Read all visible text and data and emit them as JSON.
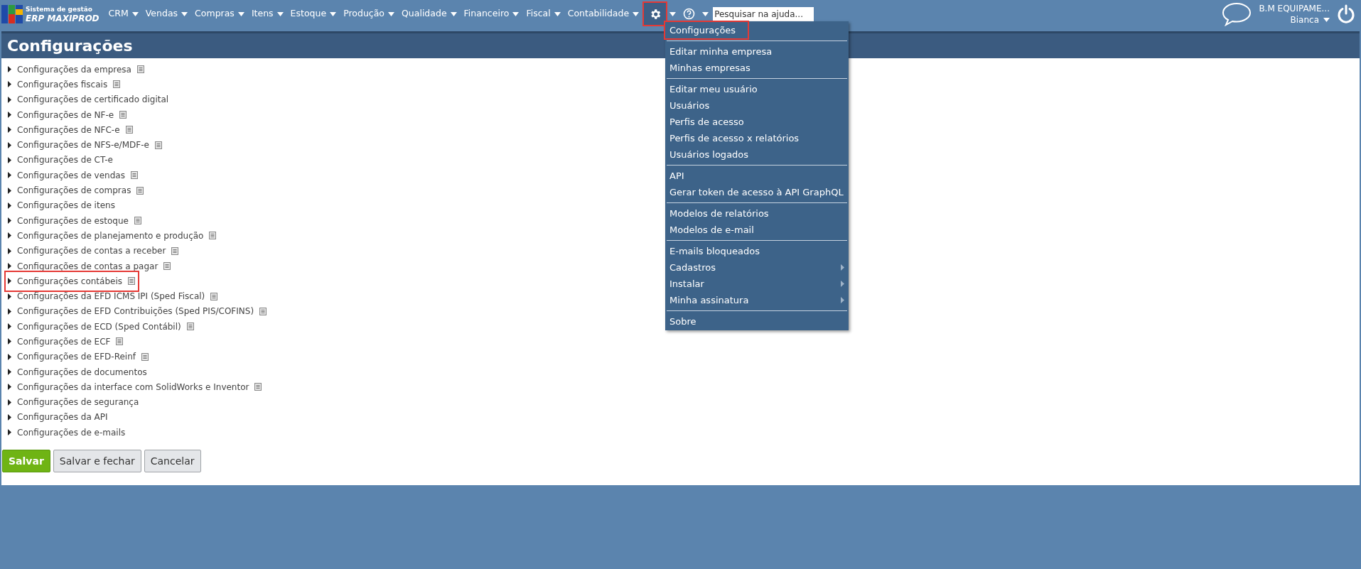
{
  "logo": {
    "line_1": "Sistema de gestão",
    "line_2": "ERP MAXIPROD"
  },
  "nav": [
    {
      "label": "CRM"
    },
    {
      "label": "Vendas"
    },
    {
      "label": "Compras"
    },
    {
      "label": "Itens"
    },
    {
      "label": "Estoque"
    },
    {
      "label": "Produção"
    },
    {
      "label": "Qualidade"
    },
    {
      "label": "Financeiro"
    },
    {
      "label": "Fiscal"
    },
    {
      "label": "Contabilidade"
    }
  ],
  "settings_button": {
    "highlighted": true
  },
  "search": {
    "placeholder": "Pesquisar na ajuda..."
  },
  "user": {
    "company": "B.M EQUIPAME...",
    "name": "Bianca"
  },
  "page_title": "Configurações",
  "sections": [
    {
      "label": "Configurações da empresa",
      "doc": true,
      "highlighted": false
    },
    {
      "label": "Configurações fiscais",
      "doc": true,
      "highlighted": false
    },
    {
      "label": "Configurações de certificado digital",
      "doc": false,
      "highlighted": false
    },
    {
      "label": "Configurações de NF-e",
      "doc": true,
      "highlighted": false
    },
    {
      "label": "Configurações de NFC-e",
      "doc": true,
      "highlighted": false
    },
    {
      "label": "Configurações de NFS-e/MDF-e",
      "doc": true,
      "highlighted": false
    },
    {
      "label": "Configurações de CT-e",
      "doc": false,
      "highlighted": false
    },
    {
      "label": "Configurações de vendas",
      "doc": true,
      "highlighted": false
    },
    {
      "label": "Configurações de compras",
      "doc": true,
      "highlighted": false
    },
    {
      "label": "Configurações de itens",
      "doc": false,
      "highlighted": false
    },
    {
      "label": "Configurações de estoque",
      "doc": true,
      "highlighted": false
    },
    {
      "label": "Configurações de planejamento e produção",
      "doc": true,
      "highlighted": false
    },
    {
      "label": "Configurações de contas a receber",
      "doc": true,
      "highlighted": false
    },
    {
      "label": "Configurações de contas a pagar",
      "doc": true,
      "highlighted": false
    },
    {
      "label": "Configurações contábeis",
      "doc": true,
      "highlighted": true
    },
    {
      "label": "Configurações da EFD ICMS IPI (Sped Fiscal)",
      "doc": true,
      "highlighted": false
    },
    {
      "label": "Configurações de EFD Contribuições (Sped PIS/COFINS)",
      "doc": true,
      "highlighted": false
    },
    {
      "label": "Configurações de ECD (Sped Contábil)",
      "doc": true,
      "highlighted": false
    },
    {
      "label": "Configurações de ECF",
      "doc": true,
      "highlighted": false
    },
    {
      "label": "Configurações de EFD-Reinf",
      "doc": true,
      "highlighted": false
    },
    {
      "label": "Configurações de documentos",
      "doc": false,
      "highlighted": false
    },
    {
      "label": "Configurações da interface com SolidWorks e Inventor",
      "doc": true,
      "highlighted": false
    },
    {
      "label": "Configurações de segurança",
      "doc": false,
      "highlighted": false
    },
    {
      "label": "Configurações da API",
      "doc": false,
      "highlighted": false
    },
    {
      "label": "Configurações de e-mails",
      "doc": false,
      "highlighted": false
    }
  ],
  "buttons": [
    {
      "label": "Salvar",
      "kind": "primary"
    },
    {
      "label": "Salvar e fechar",
      "kind": "secondary"
    },
    {
      "label": "Cancelar",
      "kind": "secondary"
    }
  ],
  "settings_menu": [
    [
      {
        "label": "Configurações",
        "submenu": false,
        "highlighted": true
      }
    ],
    [
      {
        "label": "Editar minha empresa",
        "submenu": false,
        "highlighted": false
      },
      {
        "label": "Minhas empresas",
        "submenu": false,
        "highlighted": false
      }
    ],
    [
      {
        "label": "Editar meu usuário",
        "submenu": false,
        "highlighted": false
      },
      {
        "label": "Usuários",
        "submenu": false,
        "highlighted": false
      },
      {
        "label": "Perfis de acesso",
        "submenu": false,
        "highlighted": false
      },
      {
        "label": "Perfis de acesso x relatórios",
        "submenu": false,
        "highlighted": false
      },
      {
        "label": "Usuários logados",
        "submenu": false,
        "highlighted": false
      }
    ],
    [
      {
        "label": "API",
        "submenu": false,
        "highlighted": false
      },
      {
        "label": "Gerar token de acesso à API GraphQL",
        "submenu": false,
        "highlighted": false
      }
    ],
    [
      {
        "label": "Modelos de relatórios",
        "submenu": false,
        "highlighted": false
      },
      {
        "label": "Modelos de e-mail",
        "submenu": false,
        "highlighted": false
      }
    ],
    [
      {
        "label": "E-mails bloqueados",
        "submenu": false,
        "highlighted": false
      },
      {
        "label": "Cadastros",
        "submenu": true,
        "highlighted": false
      },
      {
        "label": "Instalar",
        "submenu": true,
        "highlighted": false
      },
      {
        "label": "Minha assinatura",
        "submenu": true,
        "highlighted": false
      }
    ],
    [
      {
        "label": "Sobre",
        "submenu": false,
        "highlighted": false
      }
    ]
  ]
}
